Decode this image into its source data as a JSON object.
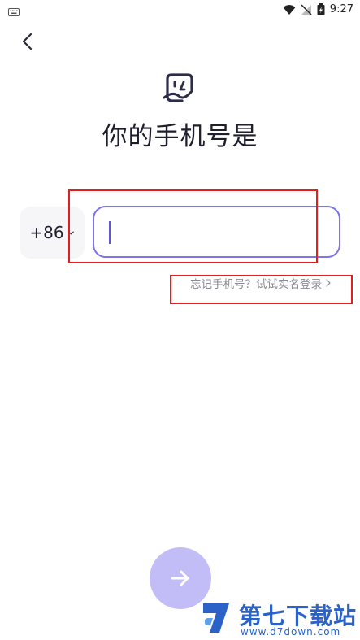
{
  "status_bar": {
    "time": "9:27"
  },
  "page": {
    "title": "你的手机号是"
  },
  "phone": {
    "country_code": "+86",
    "value": "",
    "placeholder": ""
  },
  "links": {
    "forgot_phone": "忘记手机号？试试实名登录"
  },
  "watermark": {
    "title": "第七下载站",
    "url": "www.d7down.com"
  },
  "colors": {
    "accent": "#7c74e8",
    "next_button": "#c2bdf7",
    "annotation": "#e0201f",
    "watermark": "#2b62c8"
  }
}
